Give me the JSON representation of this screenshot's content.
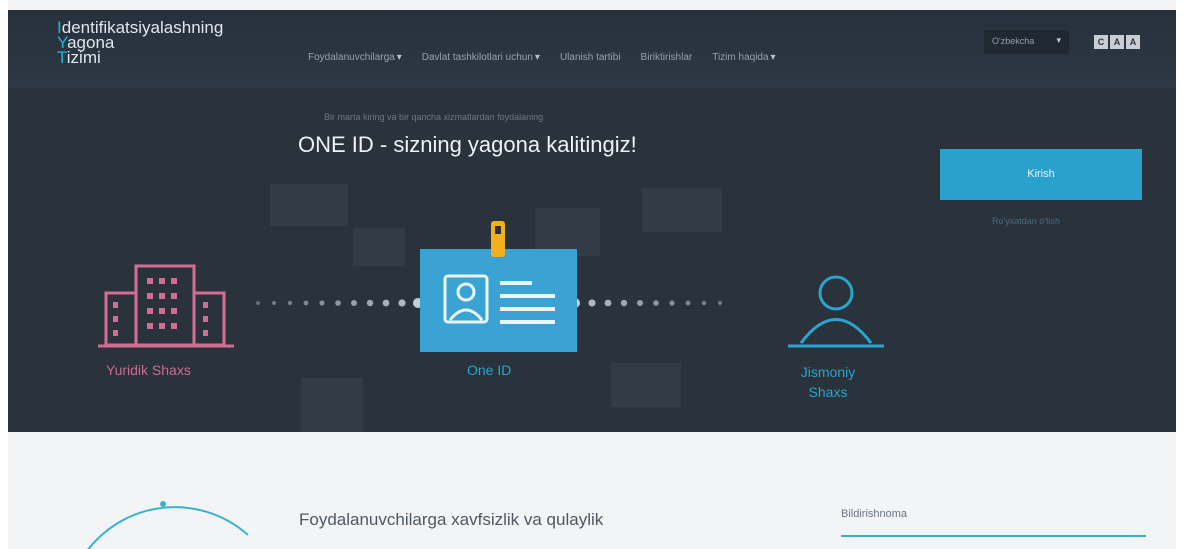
{
  "logo": {
    "line1_first": "I",
    "line1_rest": "dentifikatsiyalashning",
    "line2_first": "Y",
    "line2_rest": "agona",
    "line3_first": "T",
    "line3_rest": "izimi"
  },
  "nav": {
    "items": [
      {
        "label": "Foydalanuvchilarga",
        "has_caret": true
      },
      {
        "label": "Davlat tashkilotlari uchun",
        "has_caret": true
      },
      {
        "label": "Ulanish tartibi",
        "has_caret": false
      },
      {
        "label": "Biriktirishlar",
        "has_caret": false
      },
      {
        "label": "Tizim haqida",
        "has_caret": true
      }
    ],
    "caret": "▾"
  },
  "language": {
    "selected": "O'zbekcha",
    "caret": "▾"
  },
  "accessibility": {
    "buttons": [
      "C",
      "A",
      "A"
    ]
  },
  "hero": {
    "subtitle": "Bir marta kiring va bir qancha xizmatlardan foydalaning",
    "title": "ONE ID - sizning yagona kalitingiz!",
    "login_button": "Kirish",
    "help_link": "Ro'yxatdan o'tish"
  },
  "diagram": {
    "legal_label": "Yuridik Shaxs",
    "oneid_label": "One ID",
    "person_label_line1": "Jismoniy",
    "person_label_line2": "Shaxs",
    "colors": {
      "legal": "#d46d92",
      "oneid": "#2ba4cf",
      "badge": "#3ba3d3",
      "clip": "#f2b01f",
      "dots": "#c7ced5"
    }
  },
  "lower": {
    "headline": "Foydalanuvchilarga xavfsizlik va qulaylik",
    "notice_title": "Bildirishnoma"
  },
  "colors": {
    "accent": "#2aa1cc",
    "header_bg": "#26313c",
    "hero_bg": "#2a323c"
  }
}
